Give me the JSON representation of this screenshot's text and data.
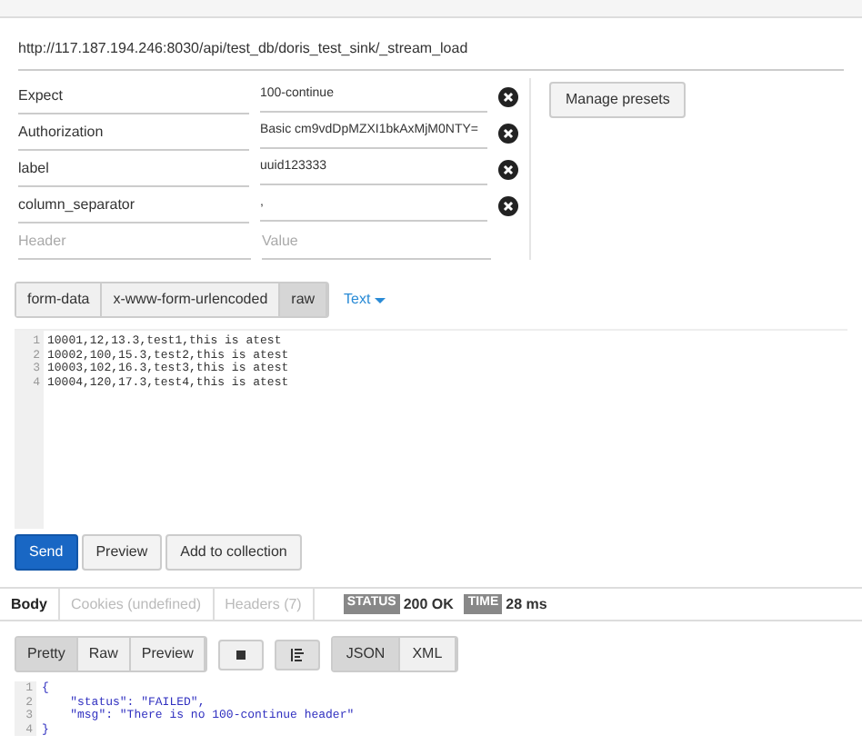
{
  "url": "http://117.187.194.246:8030/api/test_db/doris_test_sink/_stream_load",
  "headers": [
    {
      "key": "Expect",
      "value": "100-continue"
    },
    {
      "key": "Authorization",
      "value": "Basic cm9vdDpMZXI1bkAxMjM0NTY="
    },
    {
      "key": "label",
      "value": "uuid123333"
    },
    {
      "key": "column_separator",
      "value": ","
    }
  ],
  "new_header": {
    "key_placeholder": "Header",
    "value_placeholder": "Value"
  },
  "manage_presets": "Manage presets",
  "body_modes": [
    {
      "label": "form-data",
      "selected": false
    },
    {
      "label": "x-www-form-urlencoded",
      "selected": false
    },
    {
      "label": "raw",
      "selected": true
    }
  ],
  "raw_type": "Text",
  "body_lines": [
    {
      "number": "1",
      "text": "10001,12,13.3,test1,this is atest"
    },
    {
      "number": "2",
      "text": "10002,100,15.3,test2,this is atest"
    },
    {
      "number": "3",
      "text": "10003,102,16.3,test3,this is atest"
    },
    {
      "number": "4",
      "text": "10004,120,17.3,test4,this is atest"
    }
  ],
  "actions": [
    {
      "label": "Send",
      "kind": "primary"
    },
    {
      "label": "Preview",
      "kind": "plain"
    },
    {
      "label": "Add to collection",
      "kind": "plain"
    }
  ],
  "response_tabs": [
    {
      "label": "Body",
      "selected": true
    },
    {
      "label": "Cookies (undefined)",
      "selected": false
    },
    {
      "label": "Headers (7)",
      "selected": false
    }
  ],
  "status": {
    "label": "STATUS",
    "value": "200 OK"
  },
  "time": {
    "label": "TIME",
    "value": "28 ms"
  },
  "view_modes": [
    {
      "label": "Pretty",
      "selected": true
    },
    {
      "label": "Raw",
      "selected": false
    },
    {
      "label": "Preview",
      "selected": false
    }
  ],
  "formats": [
    {
      "label": "JSON",
      "selected": true
    },
    {
      "label": "XML",
      "selected": false
    }
  ],
  "response_lines": [
    {
      "number": "1",
      "text": "{"
    },
    {
      "number": "2",
      "text": "    \"status\": \"FAILED\","
    },
    {
      "number": "3",
      "text": "    \"msg\": \"There is no 100-continue header\""
    },
    {
      "number": "4",
      "text": "}"
    }
  ]
}
